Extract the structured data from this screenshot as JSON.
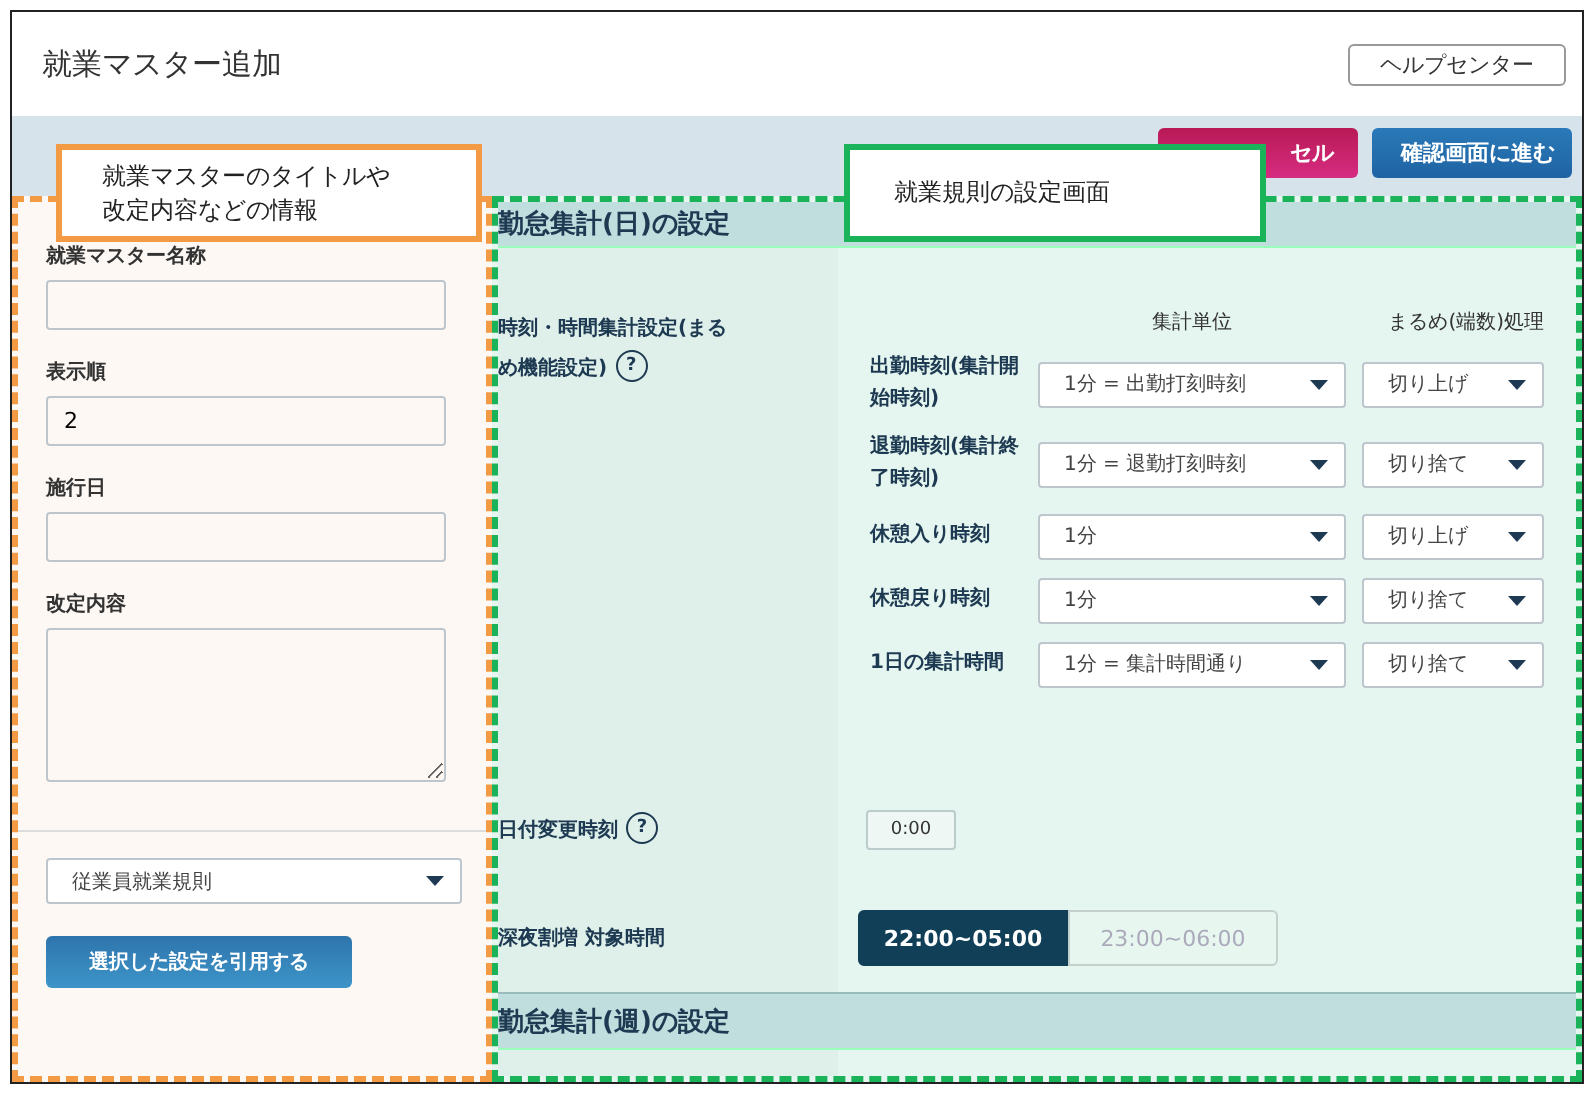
{
  "window": {
    "title": "就業マスター追加"
  },
  "header": {
    "help_button": "ヘルプセンター"
  },
  "toolbar": {
    "buttons": [
      {
        "label": "セル",
        "kind": "cancel"
      },
      {
        "label": "確認画面に進む",
        "kind": "primary"
      }
    ]
  },
  "master_info": {
    "fields": [
      {
        "label": "就業マスター名称",
        "kind": "text"
      },
      {
        "label": "表示順",
        "kind": "text",
        "value": "2"
      },
      {
        "label": "施行日",
        "kind": "text"
      },
      {
        "label": "改定内容",
        "kind": "textarea"
      }
    ],
    "template_select": "従業員就業規則",
    "copy_button": "選択した設定を引用する"
  },
  "rules": {
    "daily_title": "勤怠集計(日)の設定",
    "rounding": {
      "label": "時刻・時間集計設定(まるめ機能設定)",
      "help": "?",
      "columns": [
        "集計単位",
        "まるめ(端数)処理"
      ],
      "rows": [
        {
          "label": "出勤時刻(集計開始時刻)",
          "unit": "1分 = 出勤打刻時刻",
          "rounding": "切り上げ"
        },
        {
          "label": "退勤時刻(集計終了時刻)",
          "unit": "1分 = 退勤打刻時刻",
          "rounding": "切り捨て"
        },
        {
          "label": "休憩入り時刻",
          "unit": "1分",
          "rounding": "切り上げ"
        },
        {
          "label": "休憩戻り時刻",
          "unit": "1分",
          "rounding": "切り捨て"
        },
        {
          "label": "1日の集計時間",
          "unit": "1分 = 集計時間通り",
          "rounding": "切り捨て"
        }
      ]
    },
    "date_change": {
      "label": "日付変更時刻",
      "help": "?",
      "value": "0:00"
    },
    "night": {
      "label": "深夜割増 対象時間",
      "options": [
        {
          "label": "22:00~05:00",
          "selected": true
        },
        {
          "label": "23:00~06:00",
          "selected": false
        }
      ]
    },
    "weekly_title": "勤怠集計(週)の設定"
  },
  "callouts": [
    {
      "text": "就業マスターのタイトルや改定内容などの情報",
      "color": "#f39a45"
    },
    {
      "text": "就業規則の設定画面",
      "color": "#1bb35a"
    }
  ]
}
